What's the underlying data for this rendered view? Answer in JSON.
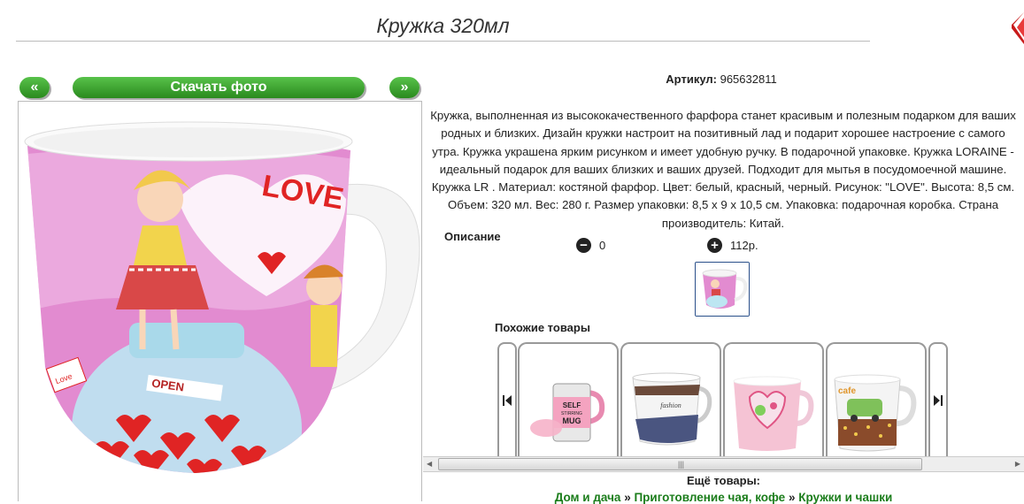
{
  "product": {
    "title": "Кружка 320мл",
    "article_label": "Артикул:",
    "article_value": "965632811",
    "description": "Кружка, выполненная из высококачественного фарфора станет красивым и полезным подарком для ваших родных и близких. Дизайн кружки настроит на позитивный лад и подарит хорошее настроение с самого утра. Кружка украшена ярким рисунком и имеет удобную ручку. В подарочной упаковке. Кружка LORAINE - идеальный подарок для ваших близких и ваших друзей. Подходит для мытья в посудомоечной машине. Кружка LR . Материал: костяной фарфор. Цвет: белый, красный, черный. Рисунок: \"LOVE\". Высота: 8,5 см. Объем: 320 мл. Вес: 280 г. Размер упаковки: 8,5 х 9 х 10,5 см. Упаковка: подарочная коробка. Страна производитель: Китай.",
    "description_label": "Описание",
    "quantity": "0",
    "price": "112р."
  },
  "nav": {
    "prev_label": "«",
    "download_label": "Скачать фото",
    "next_label": "»"
  },
  "mug_print": {
    "word": "LOVE",
    "jar_label": "OPEN",
    "tag": "Love"
  },
  "similar": {
    "title": "Похожие товары",
    "cards": [
      {
        "print": "SELF STIRRING MUG"
      },
      {
        "print": "fashion"
      },
      {
        "print": ""
      },
      {
        "print": "cafe"
      }
    ]
  },
  "more": {
    "title": "Ещё товары:",
    "breadcrumb": [
      "Дом и дача",
      "Приготовление чая, кофе",
      "Кружки и чашки"
    ],
    "separator": "»"
  },
  "colors": {
    "button_green": "#3aa52d",
    "link_green": "#1b7d1b",
    "mug_pink": "#e28bd0",
    "close_red": "#d32020"
  }
}
